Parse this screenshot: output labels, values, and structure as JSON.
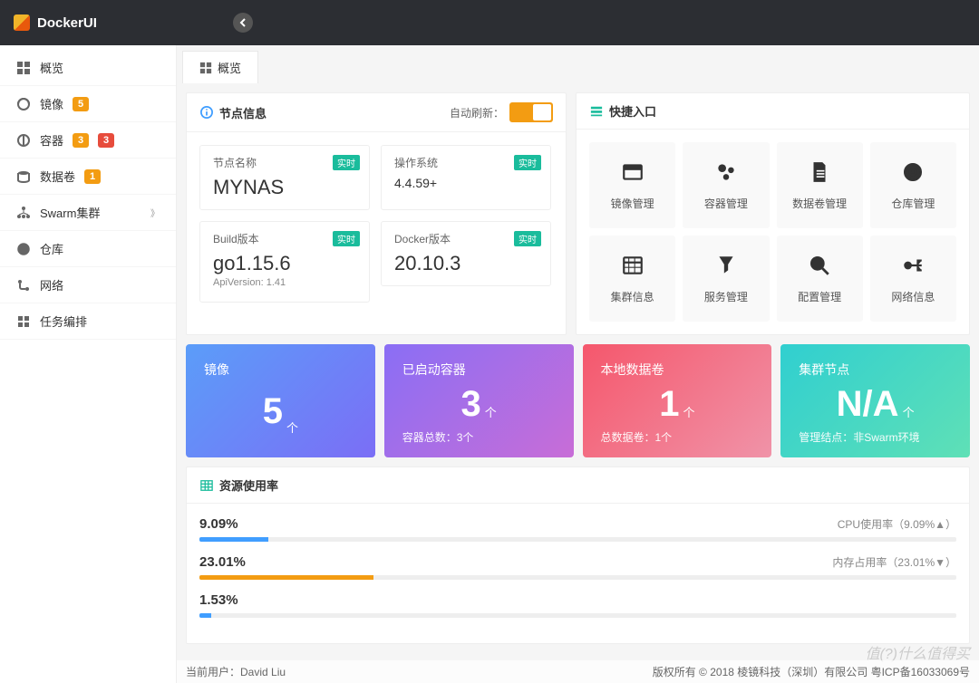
{
  "app": {
    "title": "DockerUI"
  },
  "sidebar": {
    "items": [
      {
        "label": "概览",
        "badges": []
      },
      {
        "label": "镜像",
        "badges": [
          {
            "n": "5",
            "c": "orange"
          }
        ]
      },
      {
        "label": "容器",
        "badges": [
          {
            "n": "3",
            "c": "orange"
          },
          {
            "n": "3",
            "c": "red"
          }
        ]
      },
      {
        "label": "数据卷",
        "badges": [
          {
            "n": "1",
            "c": "orange"
          }
        ]
      },
      {
        "label": "Swarm集群",
        "badges": [],
        "chev": true
      },
      {
        "label": "仓库",
        "badges": []
      },
      {
        "label": "网络",
        "badges": []
      },
      {
        "label": "任务编排",
        "badges": []
      }
    ]
  },
  "tab": {
    "label": "概览"
  },
  "nodePanel": {
    "title": "节点信息",
    "autoRefreshLabel": "自动刷新：",
    "rtBadge": "实时",
    "cards": [
      {
        "lbl": "节点名称",
        "val": "MYNAS",
        "rt": true
      },
      {
        "lbl": "操作系统",
        "val": "4.4.59+",
        "rt": true,
        "small": true
      },
      {
        "lbl": "Docker版本",
        "val": "20.10.3",
        "rt": true,
        "col": 2
      },
      {
        "lbl": "Build版本",
        "val": "go1.15.6",
        "sub": "ApiVersion: 1.41",
        "rt": true
      }
    ]
  },
  "shortcutPanel": {
    "title": "快捷入口",
    "items": [
      {
        "label": "镜像管理"
      },
      {
        "label": "容器管理"
      },
      {
        "label": "数据卷管理"
      },
      {
        "label": "仓库管理"
      },
      {
        "label": "集群信息"
      },
      {
        "label": "服务管理"
      },
      {
        "label": "配置管理"
      },
      {
        "label": "网络信息"
      }
    ]
  },
  "stats": [
    {
      "title": "镜像",
      "num": "5",
      "unit": "个",
      "foot": "",
      "cls": "g-blue"
    },
    {
      "title": "已启动容器",
      "num": "3",
      "unit": "个",
      "foot": "容器总数：3个",
      "cls": "g-purple"
    },
    {
      "title": "本地数据卷",
      "num": "1",
      "unit": "个",
      "foot": "总数据卷：1个",
      "cls": "g-orange"
    },
    {
      "title": "集群节点",
      "num": "N/A",
      "unit": "个",
      "foot": "管理结点：非Swarm环境",
      "cls": "g-teal"
    }
  ],
  "usage": {
    "title": "资源使用率",
    "items": [
      {
        "pct": "9.09%",
        "lbl": "CPU使用率（9.09%▲）",
        "w": "9.09%",
        "c": "bar-blue"
      },
      {
        "pct": "23.01%",
        "lbl": "内存占用率（23.01%▼）",
        "w": "23.01%",
        "c": "bar-orange"
      },
      {
        "pct": "1.53%",
        "lbl": "",
        "w": "1.53%",
        "c": "bar-blue"
      }
    ]
  },
  "footer": {
    "left": "当前用户：David Liu",
    "right": "版权所有 © 2018 棱镜科技（深圳）有限公司  粤ICP备16033069号"
  },
  "watermark": "值(?)什么值得买"
}
